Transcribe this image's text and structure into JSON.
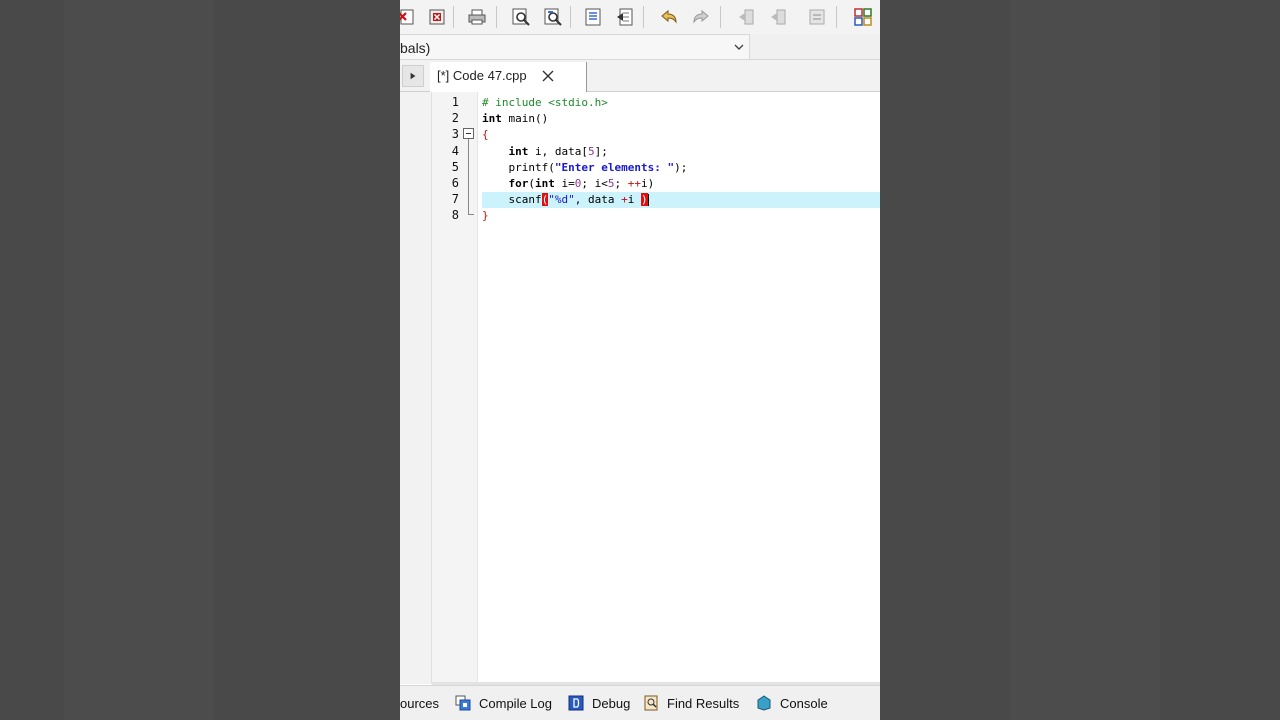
{
  "colors": {
    "background": "#4a4a4a",
    "current_line": "#ccf2fb",
    "preprocessor": "#1e8a2a",
    "string": "#1a1acc",
    "number": "#8a3a8a",
    "operator": "#c01010",
    "bracket_error": "#e01010"
  },
  "toolbar": {
    "icons": [
      "close-all-icon",
      "close-icon",
      "print-icon",
      "find-icon",
      "replace-icon",
      "goto-icon",
      "bookmark-icon",
      "undo-icon",
      "redo-icon",
      "indent-icon",
      "unindent-icon",
      "toggle-comment-icon",
      "project-options-icon"
    ]
  },
  "scope": {
    "value": "bals)"
  },
  "tab": {
    "label": "[*] Code 47.cpp"
  },
  "editor": {
    "line_numbers": [
      "1",
      "2",
      "3",
      "4",
      "5",
      "6",
      "7",
      "8"
    ],
    "lines": {
      "l1": {
        "pp": "# include <stdio.h>"
      },
      "l2": {
        "kw": "int",
        "rest": " main()"
      },
      "l3": {
        "brace": "{"
      },
      "l4": {
        "indent": "    ",
        "kw": "int",
        "rest": " i, data[",
        "num": "5",
        "end": "];"
      },
      "l5": {
        "indent": "    ",
        "fn": "printf(",
        "str": "\"Enter elements: \"",
        "end": ");"
      },
      "l6": {
        "indent": "    ",
        "kw": "for",
        "a": "(",
        "kw2": "int",
        "b": " i=",
        "n0": "0",
        "c": "; i<",
        "n5": "5",
        "d": "; ",
        "op": "++",
        "e": "i)"
      },
      "l7": {
        "indent": "    ",
        "fn": "scanf",
        "open": "(",
        "str": "\"%d\"",
        "mid": ", data ",
        "op": "+",
        "end": "i ",
        "close": ")"
      },
      "l8": {
        "brace": "}"
      }
    }
  },
  "bottom_tabs": {
    "resources": "ources",
    "compile_log": "Compile Log",
    "debug": "Debug",
    "find_results": "Find Results",
    "console": "Console"
  }
}
